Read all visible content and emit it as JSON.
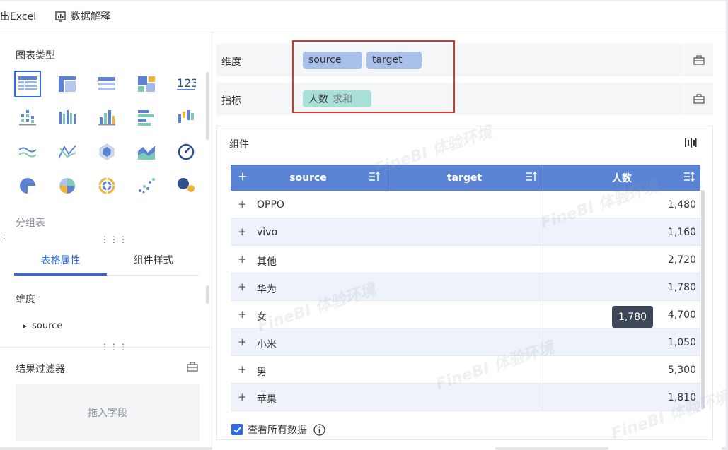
{
  "toolbar": {
    "export_label": "导出Excel",
    "export_visible": "出Excel",
    "explain_label": "数据解释"
  },
  "left": {
    "chart_type_title": "图表类型",
    "current_type": "分组表",
    "tabs": [
      {
        "label": "表格属性",
        "active": true
      },
      {
        "label": "组件样式",
        "active": false
      }
    ],
    "dimension_title": "维度",
    "dimension_node": "source",
    "filter_title": "结果过滤器",
    "drop_placeholder": "拖入字段",
    "chart_icons": [
      "table-icon",
      "cross-table-icon",
      "detail-table-icon",
      "treemap-icon",
      "kpi-icon",
      "dot-column-icon",
      "stacked-column-icon",
      "column-icon",
      "bar-icon",
      "range-column-icon",
      "line-icon",
      "radar-line-icon",
      "radar-icon",
      "area-icon",
      "gauge-icon",
      "pie-icon",
      "rose-pie-icon",
      "funnel-ring-icon",
      "scatter-icon",
      "bubble-icon"
    ],
    "kpi_text": "123"
  },
  "config": {
    "dimension_label": "维度",
    "measure_label": "指标",
    "dimension_fields": [
      "source",
      "target"
    ],
    "measure_field": "人数",
    "measure_agg": "求和"
  },
  "widget": {
    "title": "组件",
    "columns": [
      "source",
      "target",
      "人数"
    ],
    "rows": [
      {
        "name": "OPPO",
        "value": "1,480"
      },
      {
        "name": "vivo",
        "value": "1,160"
      },
      {
        "name": "其他",
        "value": "2,720"
      },
      {
        "name": "华为",
        "value": "1,780"
      },
      {
        "name": "女",
        "value": "4,700"
      },
      {
        "name": "小米",
        "value": "1,050"
      },
      {
        "name": "男",
        "value": "5,300"
      },
      {
        "name": "苹果",
        "value": "1,810"
      }
    ],
    "tooltip": "1,780",
    "show_all_label": "查看所有数据"
  },
  "watermark": "FineBI 体验环境",
  "colors": {
    "accent": "#2f6ae0",
    "header_bg": "#5b83d4",
    "dim_pill": "#a9c0ea",
    "measure_pill": "#a8dfd6",
    "highlight": "#e0332f"
  }
}
